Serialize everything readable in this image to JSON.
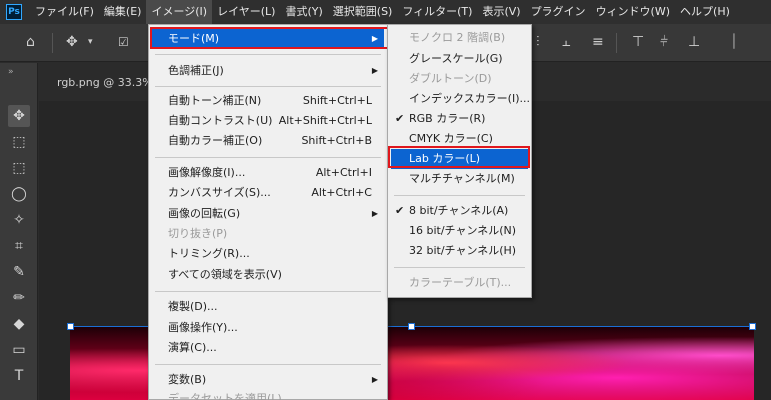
{
  "app": {
    "logo": "Ps"
  },
  "menubar": {
    "items": [
      {
        "label": "ファイル(F)"
      },
      {
        "label": "編集(E)"
      },
      {
        "label": "イメージ(I)"
      },
      {
        "label": "レイヤー(L)"
      },
      {
        "label": "書式(Y)"
      },
      {
        "label": "選択範囲(S)"
      },
      {
        "label": "フィルター(T)"
      },
      {
        "label": "表示(V)"
      },
      {
        "label": "プラグイン"
      },
      {
        "label": "ウィンドウ(W)"
      },
      {
        "label": "ヘルプ(H)"
      }
    ]
  },
  "document": {
    "tab_label": "rgb.png @ 33.3%"
  },
  "image_menu": {
    "items": [
      {
        "label": "モード(M)",
        "submenu": true,
        "highlighted": true
      },
      {
        "label": "色調補正(J)",
        "submenu": true
      },
      {
        "label": "自動トーン補正(N)",
        "shortcut": "Shift+Ctrl+L"
      },
      {
        "label": "自動コントラスト(U)",
        "shortcut": "Alt+Shift+Ctrl+L"
      },
      {
        "label": "自動カラー補正(O)",
        "shortcut": "Shift+Ctrl+B"
      },
      {
        "label": "画像解像度(I)...",
        "shortcut": "Alt+Ctrl+I"
      },
      {
        "label": "カンバスサイズ(S)...",
        "shortcut": "Alt+Ctrl+C"
      },
      {
        "label": "画像の回転(G)",
        "submenu": true
      },
      {
        "label": "切り抜き(P)",
        "disabled": true
      },
      {
        "label": "トリミング(R)..."
      },
      {
        "label": "すべての領域を表示(V)"
      },
      {
        "label": "複製(D)..."
      },
      {
        "label": "画像操作(Y)..."
      },
      {
        "label": "演算(C)..."
      },
      {
        "label": "変数(B)",
        "submenu": true
      },
      {
        "label": "データセットを適用(L)...",
        "disabled": true
      }
    ]
  },
  "mode_submenu": {
    "items": [
      {
        "label": "モノクロ 2 階調(B)",
        "disabled": true
      },
      {
        "label": "グレースケール(G)"
      },
      {
        "label": "ダブルトーン(D)",
        "disabled": true
      },
      {
        "label": "インデックスカラー(I)..."
      },
      {
        "label": "RGB カラー(R)",
        "checked": true
      },
      {
        "label": "CMYK カラー(C)"
      },
      {
        "label": "Lab カラー(L)",
        "highlighted": true
      },
      {
        "label": "マルチチャンネル(M)"
      },
      {
        "label": "8 bit/チャンネル(A)",
        "checked": true
      },
      {
        "label": "16 bit/チャンネル(N)"
      },
      {
        "label": "32 bit/チャンネル(H)"
      },
      {
        "label": "カラーテーブル(T)...",
        "disabled": true
      }
    ]
  },
  "glyphs": {
    "check": "✔",
    "arrow": "▶"
  },
  "colors": {
    "highlight": "#0c64d1",
    "callout": "#e0171d"
  }
}
